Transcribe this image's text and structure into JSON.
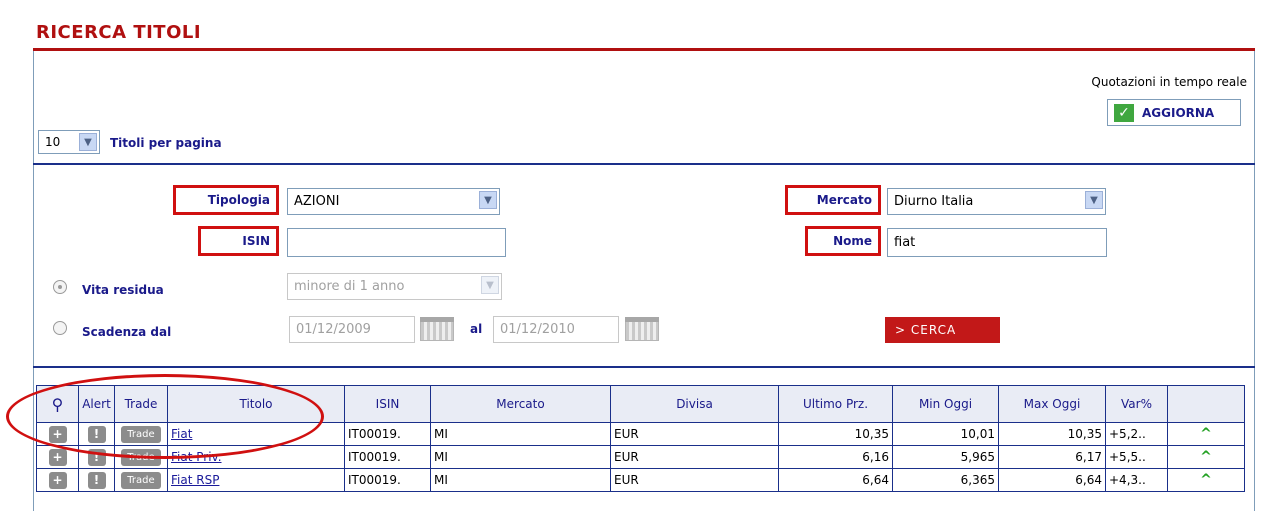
{
  "page": {
    "title": "RICERCA TITOLI",
    "realtime_label": "Quotazioni in tempo reale",
    "update_button": "AGGIORNA",
    "per_page_value": "10",
    "per_page_label": "Titoli per pagina"
  },
  "form": {
    "tipologia_label": "Tipologia",
    "tipologia_value": "AZIONI",
    "mercato_label": "Mercato",
    "mercato_value": "Diurno Italia",
    "isin_label": "ISIN",
    "isin_value": "",
    "nome_label": "Nome",
    "nome_value": "fiat",
    "vita_residua_label": "Vita residua",
    "vita_residua_value": "minore di 1 anno",
    "scadenza_label": "Scadenza dal",
    "date_from": "01/12/2009",
    "al_label": "al",
    "date_to": "01/12/2010",
    "search_button": "> CERCA"
  },
  "table": {
    "headers": [
      "Alert",
      "Trade",
      "Titolo",
      "ISIN",
      "Mercato",
      "Divisa",
      "Ultimo Prz.",
      "Min Oggi",
      "Max Oggi",
      "Var%"
    ],
    "trade_label": "Trade",
    "rows": [
      {
        "titolo": "Fiat",
        "isin": "IT00019.",
        "mercato": "MI",
        "divisa": "EUR",
        "ultimo": "10,35",
        "min": "10,01",
        "max": "10,35",
        "var": "+5,2.."
      },
      {
        "titolo": "Fiat Priv.",
        "isin": "IT00019.",
        "mercato": "MI",
        "divisa": "EUR",
        "ultimo": "6,16",
        "min": "5,965",
        "max": "6,17",
        "var": "+5,5.."
      },
      {
        "titolo": "Fiat RSP",
        "isin": "IT00019.",
        "mercato": "MI",
        "divisa": "EUR",
        "ultimo": "6,64",
        "min": "6,365",
        "max": "6,64",
        "var": "+4,3.."
      }
    ]
  },
  "colors": {
    "accent_red": "#b01010",
    "annotation_red": "#d01010",
    "label_blue": "#1a1a8a",
    "table_border": "#1a2f8a",
    "up_green": "#22a022"
  }
}
